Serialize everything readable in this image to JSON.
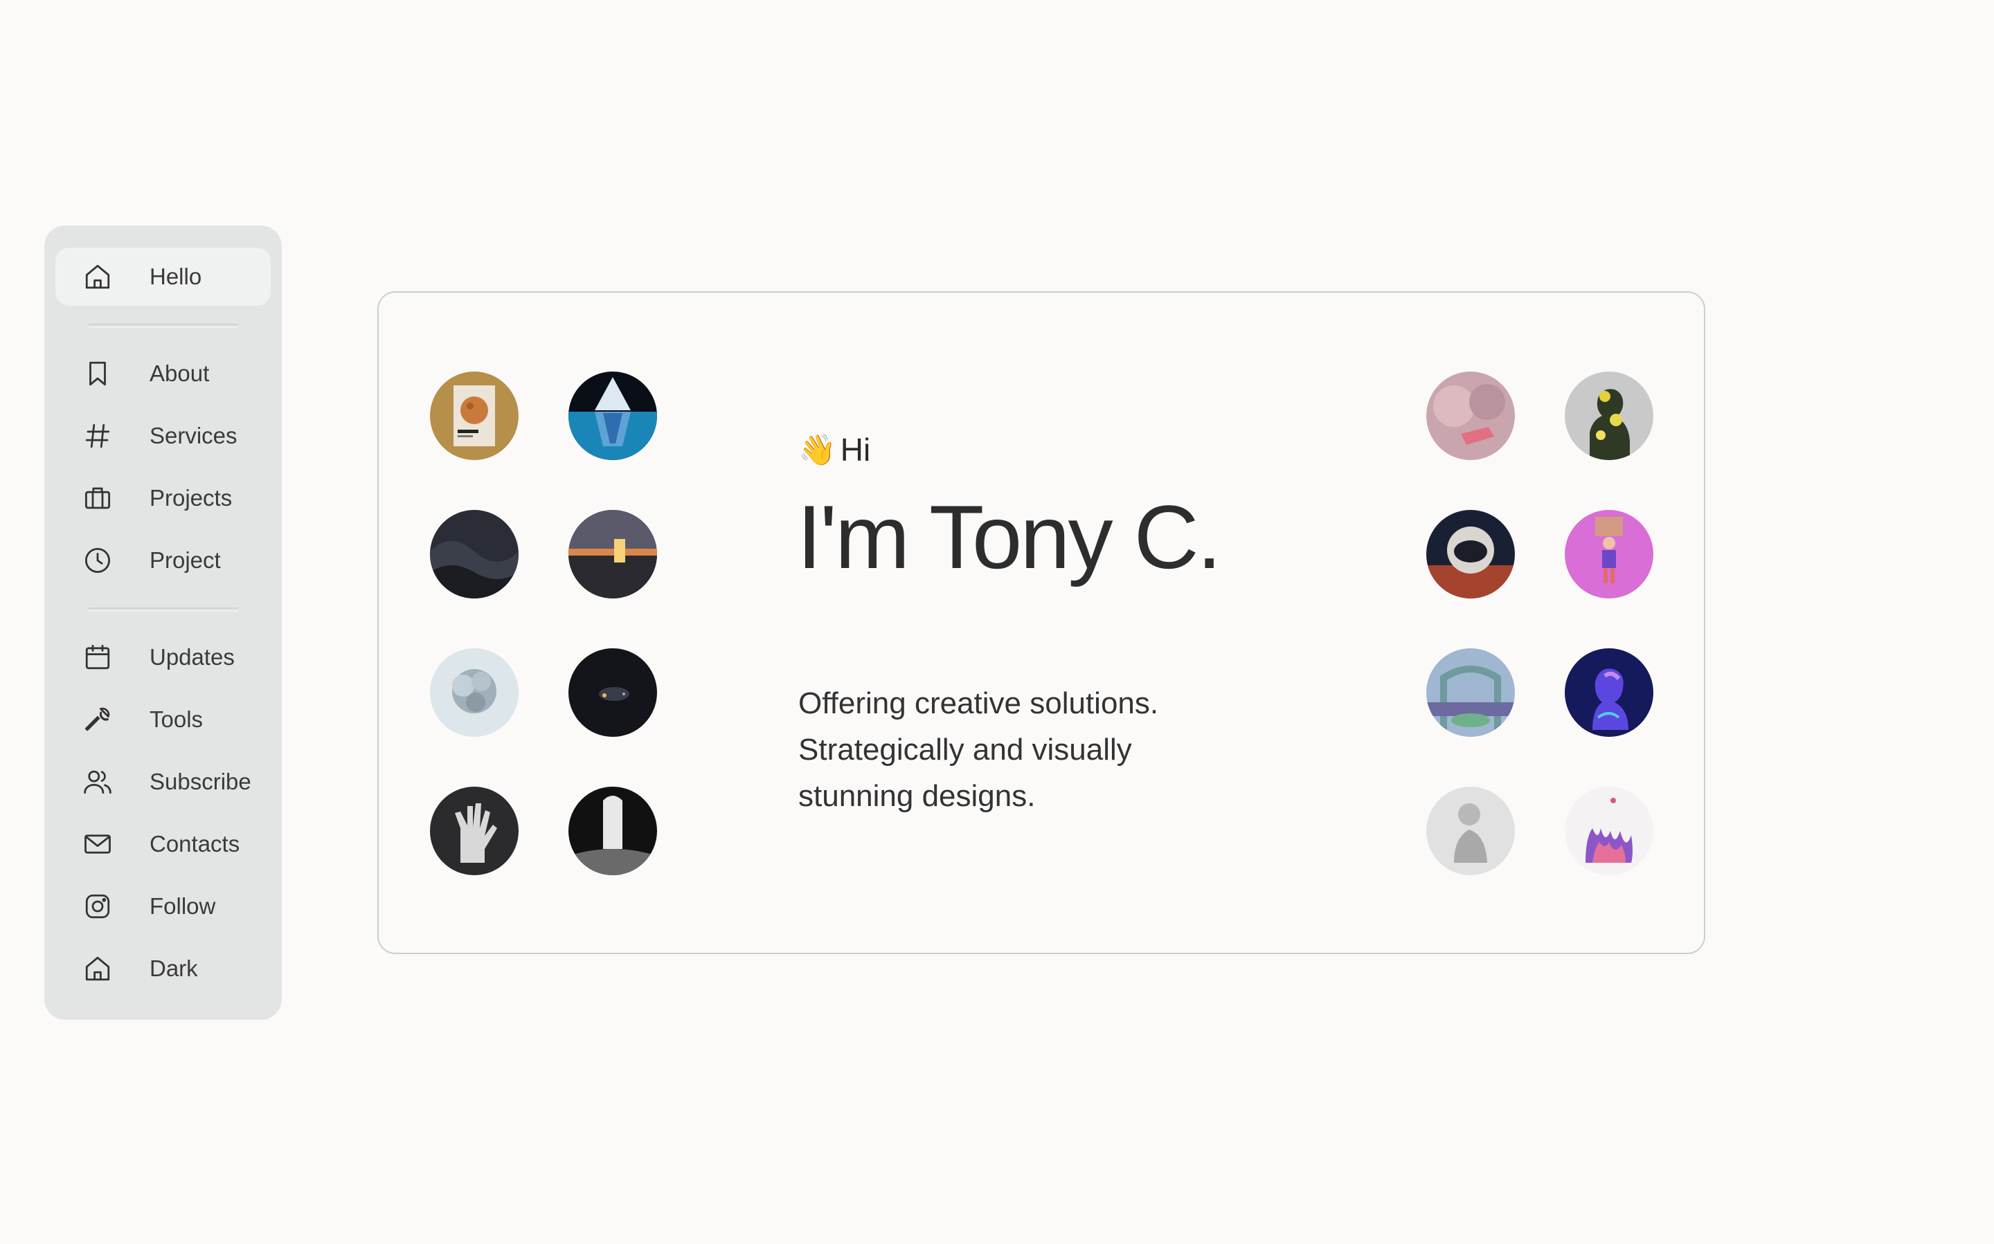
{
  "sidebar": {
    "items": [
      {
        "label": "Hello",
        "icon": "home-icon",
        "active": true
      },
      {
        "label": "About",
        "icon": "bookmark-icon"
      },
      {
        "label": "Services",
        "icon": "hash-icon"
      },
      {
        "label": "Projects",
        "icon": "briefcase-icon"
      },
      {
        "label": "Project",
        "icon": "clock-icon"
      },
      {
        "label": "Updates",
        "icon": "calendar-icon"
      },
      {
        "label": "Tools",
        "icon": "wrench-icon"
      },
      {
        "label": "Subscribe",
        "icon": "users-icon"
      },
      {
        "label": "Contacts",
        "icon": "mail-icon"
      },
      {
        "label": "Follow",
        "icon": "instagram-icon"
      },
      {
        "label": "Dark",
        "icon": "home-icon"
      }
    ]
  },
  "hero": {
    "wave_emoji": "👋",
    "greeting": "Hi",
    "title": "I'm Tony C.",
    "subtitle_lines": [
      "Offering creative solutions.",
      "Strategically and visually",
      "stunning designs."
    ]
  },
  "colors": {
    "background": "#fcfaf9",
    "sidebar_bg": "#e3e5e4",
    "active_item_bg": "#f0f2f1",
    "card_border": "#c9cfcc",
    "text": "#2a2a2a"
  }
}
